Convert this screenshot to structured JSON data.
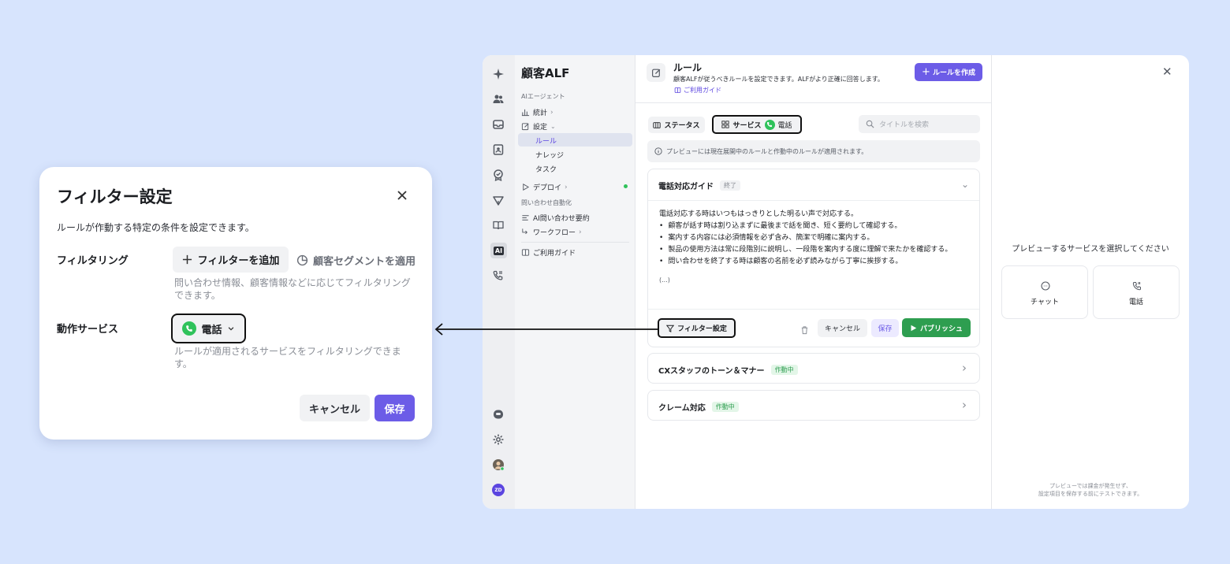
{
  "modal": {
    "title": "フィルター設定",
    "description": "ルールが作動する特定の条件を設定できます。",
    "filtering_label": "フィルタリング",
    "add_filter_label": "フィルターを追加",
    "apply_segment_label": "顧客セグメントを適用",
    "filtering_help": "問い合わせ情報、顧客情報などに応じてフィルタリングできます。",
    "service_label": "動作サービス",
    "service_value": "電話",
    "service_help": "ルールが適用されるサービスをフィルタリングできます。",
    "cancel_label": "キャンセル",
    "save_label": "保存"
  },
  "nav": {
    "title": "顧客ALF",
    "section_agent": "AIエージェント",
    "stats": "統計",
    "settings": "設定",
    "rules": "ルール",
    "knowledge": "ナレッジ",
    "tasks": "タスク",
    "deploy": "デプロイ",
    "section_automation": "問い合わせ自動化",
    "ai_summary": "AI問い合わせ要約",
    "workflow": "ワークフロー",
    "guide": "ご利用ガイド"
  },
  "rail": {
    "ai_label": "AI",
    "logo_label": "ZD"
  },
  "header": {
    "title": "ルール",
    "description": "顧客ALFが従うべきルールを設定できます。ALFがより正確に回答します。",
    "guide_link": "ご利用ガイド",
    "create_button": "ルールを作成"
  },
  "filters": {
    "status": "ステータス",
    "service": "サービス",
    "service_value": "電話",
    "search_placeholder": "タイトルを検索"
  },
  "notice": "プレビューには現在展開中のルールと作動中のルールが適用されます。",
  "rule_expanded": {
    "title": "電話対応ガイド",
    "badge": "終了",
    "body_intro": "電話対応する時はいつもはっきりとした明るい声で対応する。",
    "bullets": [
      "顧客が話す時は割り込まずに最後まで話を聞き、短く要約して確認する。",
      "案内する内容には必須情報を必ず含み、簡潔で明確に案内する。",
      "製品の使用方法は常に段階別に説明し、一段階を案内する度に理解で来たかを確認する。",
      "問い合わせを終了する時は顧客の名前を必ず読みながら丁寧に挨拶する。"
    ],
    "ellipsis": "(...)",
    "filter_button": "フィルター設定",
    "cancel": "キャンセル",
    "save": "保存",
    "publish": "パブリッシュ"
  },
  "rules": [
    {
      "title": "CXスタッフのトーン＆マナー",
      "badge": "作動中"
    },
    {
      "title": "クレーム対応",
      "badge": "作動中"
    }
  ],
  "preview": {
    "prompt": "プレビューするサービスを選択してください",
    "chat": "チャット",
    "phone": "電話",
    "footnote_1": "プレビューでは課金が発生せず、",
    "footnote_2": "設定項目を保存する前にテストできます。"
  },
  "colors": {
    "primary": "#6c5ce7",
    "publish_green": "#2e9e50",
    "phone_green": "#2fc25b",
    "active_badge_bg": "#e3f6e8",
    "background": "#d7e4fd"
  }
}
